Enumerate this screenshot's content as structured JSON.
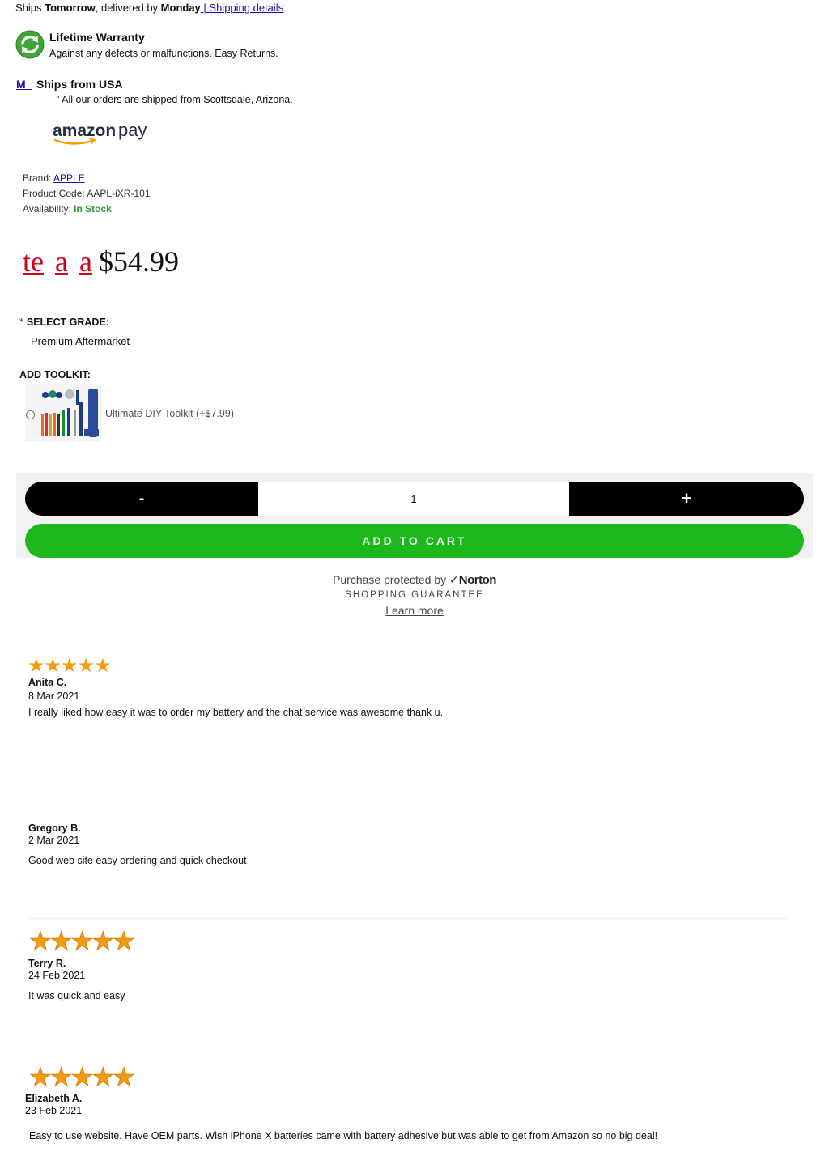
{
  "shipping": {
    "prefix": "Ships ",
    "when": "Tomorrow",
    "middle": ", delivered by ",
    "day": "Monday",
    "sep": " | ",
    "details_link": "Shipping details"
  },
  "warranty": {
    "title": "Lifetime Warranty",
    "description": "Against any defects or malfunctions. Easy Returns."
  },
  "origin": {
    "mark": "M_",
    "title": "Ships from USA",
    "description": "' All our orders are shipped from Scottsdale, Arizona."
  },
  "payment": {
    "logo_word1": "amazon",
    "logo_word2": "pay"
  },
  "product": {
    "brand_label": "Brand: ",
    "brand": "APPLE",
    "code_label": "Product Code: ",
    "code": "AAPL-iXR-101",
    "availability_label": "Availability: ",
    "availability": "In Stock",
    "availability_color": "#2e9a3a"
  },
  "price": {
    "fragments": [
      "te",
      "a",
      "a"
    ],
    "value": "$54.99"
  },
  "grade": {
    "required_mark": "*",
    "label": "SELECT GRADE:",
    "value": "Premium Aftermarket"
  },
  "toolkit": {
    "label": "ADD TOOLKIT:",
    "option": "Ultimate DIY Toolkit (+$7.99)"
  },
  "cart": {
    "minus": "-",
    "quantity": "1",
    "plus": "+",
    "add_to_cart": "ADD TO CART",
    "accent_color": "#1db81d"
  },
  "norton": {
    "protected_by": "Purchase protected by ",
    "brand": "Norton",
    "guarantee": "SHOPPING GUARANTEE",
    "learn_more": "Learn more"
  },
  "reviews": [
    {
      "stars": "★★★★★",
      "rating": 5,
      "name": "Anita C.",
      "date": "8 Mar 2021",
      "text": "I really liked how easy it was to order my battery and the chat service was awesome thank u."
    },
    {
      "stars": "",
      "rating": null,
      "name": "Gregory B.",
      "date": "2 Mar 2021",
      "text": "Good web site easy ordering and quick checkout"
    },
    {
      "stars": "★★★★★",
      "rating": 5,
      "name": "Terry R.",
      "date": "24 Feb 2021",
      "text": "It was quick and easy"
    },
    {
      "stars": "★★★★★",
      "rating": 5,
      "name": "Elizabeth A.",
      "date": "23 Feb 2021",
      "text": "Easy to use website. Have OEM parts. Wish iPhone X batteries came with battery adhesive but was able to get from Amazon so no big deal!"
    }
  ],
  "colors": {
    "star": "#f39c12",
    "price_fragment": "#d0021b",
    "link": "#1a0dab"
  }
}
